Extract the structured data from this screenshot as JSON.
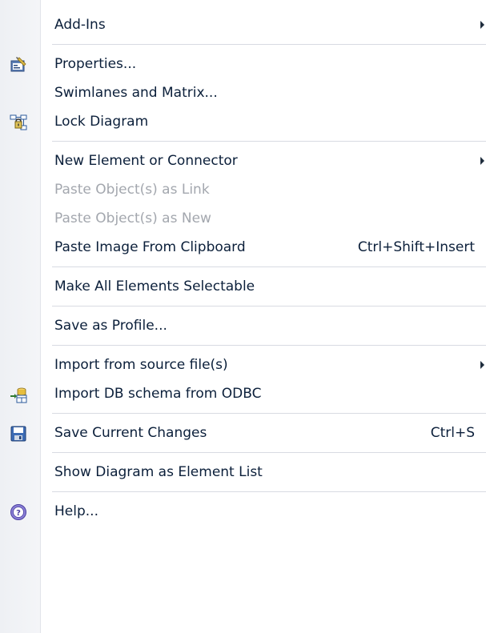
{
  "menu": {
    "items": [
      {
        "label": "Add-Ins"
      },
      {
        "label": "Properties..."
      },
      {
        "label": "Swimlanes and Matrix..."
      },
      {
        "label": "Lock Diagram"
      },
      {
        "label": "New Element or Connector"
      },
      {
        "label": "Paste Object(s) as Link"
      },
      {
        "label": "Paste Object(s) as New"
      },
      {
        "label": "Paste Image From Clipboard",
        "shortcut": "Ctrl+Shift+Insert"
      },
      {
        "label": "Make All Elements Selectable"
      },
      {
        "label": "Save as Profile..."
      },
      {
        "label": "Import from source file(s)"
      },
      {
        "label": "Import DB schema from ODBC"
      },
      {
        "label": "Save Current Changes",
        "shortcut": "Ctrl+S"
      },
      {
        "label": "Show Diagram as Element List"
      },
      {
        "label": "Help..."
      }
    ],
    "icons": {
      "properties": "properties-icon",
      "lock": "lock-diagram-icon",
      "import_db": "import-db-icon",
      "save": "save-icon",
      "help": "help-icon"
    }
  }
}
